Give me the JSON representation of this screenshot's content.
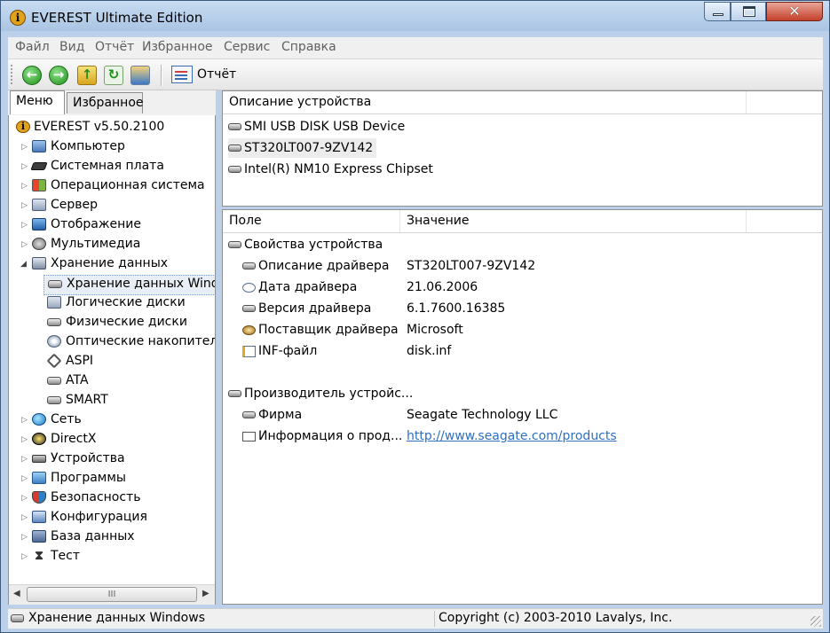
{
  "window": {
    "title": "EVEREST Ultimate Edition",
    "app_icon": "info-icon",
    "buttons": {
      "minimize": "minimize-icon",
      "maximize": "maximize-icon",
      "close": "✕"
    }
  },
  "menubar": [
    "Файл",
    "Вид",
    "Отчёт",
    "Избранное",
    "Сервис",
    "Справка"
  ],
  "toolbar": {
    "buttons": [
      "back-icon",
      "forward-icon",
      "up-icon",
      "refresh-icon",
      "users-icon"
    ],
    "report_label": "Отчёт",
    "back_glyph": "←",
    "forward_glyph": "→",
    "up_glyph": "↑",
    "refresh_glyph": "↻"
  },
  "sidebar": {
    "tabs": [
      "Меню",
      "Избранное"
    ],
    "active_tab": "Меню",
    "root": "EVEREST v5.50.2100",
    "root_glyph": "i",
    "items": [
      {
        "label": "Компьютер",
        "icon": "computer-icon"
      },
      {
        "label": "Системная плата",
        "icon": "motherboard-icon"
      },
      {
        "label": "Операционная система",
        "icon": "os-icon"
      },
      {
        "label": "Сервер",
        "icon": "server-icon"
      },
      {
        "label": "Отображение",
        "icon": "display-icon"
      },
      {
        "label": "Мультимедиа",
        "icon": "multimedia-icon"
      },
      {
        "label": "Хранение данных",
        "icon": "storage-icon",
        "expanded": true
      }
    ],
    "storage_children": [
      {
        "label": "Хранение данных Windows",
        "icon": "disk-icon",
        "selected": true
      },
      {
        "label": "Логические диски",
        "icon": "logical-disk-icon"
      },
      {
        "label": "Физические диски",
        "icon": "physical-disk-icon"
      },
      {
        "label": "Оптические накопители",
        "icon": "optical-drive-icon"
      },
      {
        "label": "ASPI",
        "icon": "aspi-icon"
      },
      {
        "label": "ATA",
        "icon": "ata-icon"
      },
      {
        "label": "SMART",
        "icon": "smart-icon"
      }
    ],
    "items_after": [
      {
        "label": "Сеть",
        "icon": "network-icon"
      },
      {
        "label": "DirectX",
        "icon": "directx-icon"
      },
      {
        "label": "Устройства",
        "icon": "devices-icon"
      },
      {
        "label": "Программы",
        "icon": "programs-icon"
      },
      {
        "label": "Безопасность",
        "icon": "security-icon"
      },
      {
        "label": "Конфигурация",
        "icon": "configuration-icon"
      },
      {
        "label": "База данных",
        "icon": "database-icon"
      },
      {
        "label": "Тест",
        "icon": "test-icon"
      }
    ],
    "test_glyph": "⧗",
    "scroll_thumb_glyph": "III",
    "scroll_left_glyph": "◀",
    "scroll_right_glyph": "▶"
  },
  "devices_panel": {
    "header": "Описание устройства",
    "devices": [
      {
        "label": "SMI USB DISK USB Device",
        "selected": false
      },
      {
        "label": "ST320LT007-9ZV142",
        "selected": true
      },
      {
        "label": "Intel(R) NM10 Express Chipset",
        "selected": false
      }
    ]
  },
  "properties_panel": {
    "headers": {
      "field": "Поле",
      "value": "Значение"
    },
    "groups": [
      {
        "title": "Свойства устройства",
        "rows": [
          {
            "field": "Описание драйвера",
            "value": "ST320LT007-9ZV142",
            "icon": "disk-icon"
          },
          {
            "field": "Дата драйвера",
            "value": "21.06.2006",
            "icon": "date-icon"
          },
          {
            "field": "Версия драйвера",
            "value": "6.1.7600.16385",
            "icon": "version-icon"
          },
          {
            "field": "Поставщик драйвера",
            "value": "Microsoft",
            "icon": "vendor-icon"
          },
          {
            "field": "INF-файл",
            "value": "disk.inf",
            "icon": "inf-file-icon"
          }
        ]
      },
      {
        "title": "Производитель устройс...",
        "rows": [
          {
            "field": "Фирма",
            "value": "Seagate Technology LLC",
            "icon": "company-icon"
          },
          {
            "field": "Информация о прод...",
            "value": "http://www.seagate.com/products",
            "icon": "product-info-icon",
            "link": true
          }
        ]
      }
    ]
  },
  "statusbar": {
    "left": "Хранение данных Windows",
    "right": "Copyright (c) 2003-2010 Lavalys, Inc."
  },
  "colors": {
    "link": "#2e6fbf",
    "selection": "#e8eef5",
    "frame": "#bcd1e9"
  }
}
